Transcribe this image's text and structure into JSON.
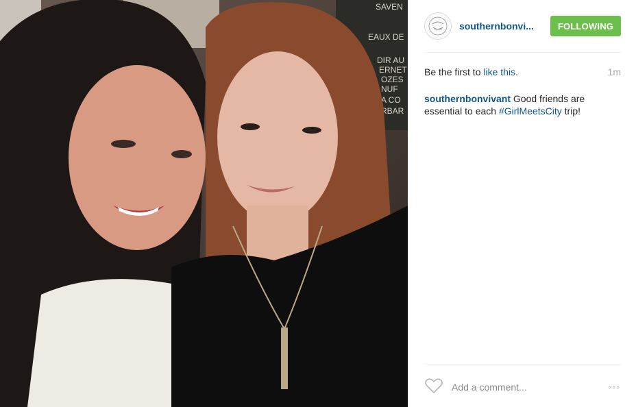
{
  "post": {
    "username": "southernbonvivant",
    "username_short": "southernbonvi...",
    "follow_label": "FOLLOWING",
    "likes_prefix": "Be the first to",
    "likes_link": "like this",
    "likes_suffix": ".",
    "timestamp": "1m",
    "caption_username": "southernbonvivant",
    "caption_text": "Good friends are essential to each",
    "caption_hashtag": "#GirlMeetsCity",
    "caption_end": "trip!",
    "add_comment_placeholder": "Add a comment...",
    "more_label": "◦◦◦"
  },
  "photo": {
    "chalkboard_text": [
      "SAVEN",
      "EAUX DE",
      "DIR AU",
      "ERNET",
      "OZES",
      "NUF",
      "A CO",
      "RBAR"
    ]
  },
  "colors": {
    "link": "#125688",
    "follow_button": "#6bc04b"
  },
  "icons": {
    "like": "heart-outline-icon",
    "more": "more-dots-icon"
  }
}
